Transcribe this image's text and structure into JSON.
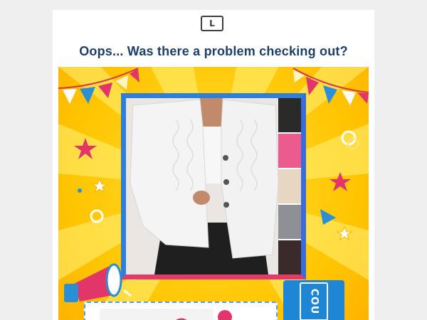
{
  "brand": {
    "logo_text": "L"
  },
  "headline": "Oops... Was there a problem checking out?",
  "hero": {
    "coupon_label": "COU",
    "colors": {
      "background": "#ffc400",
      "frame_blue": "#2f7fd8",
      "frame_pink": "#e23a6b",
      "flag_blue": "#2a8fd4",
      "flag_pink": "#e2356a",
      "heading": "#1d3f66"
    },
    "product_image": "white-textured-blazer-photo",
    "decorations": [
      "bunting-flags",
      "star-icon",
      "megaphone-icon",
      "ring-icon"
    ]
  }
}
